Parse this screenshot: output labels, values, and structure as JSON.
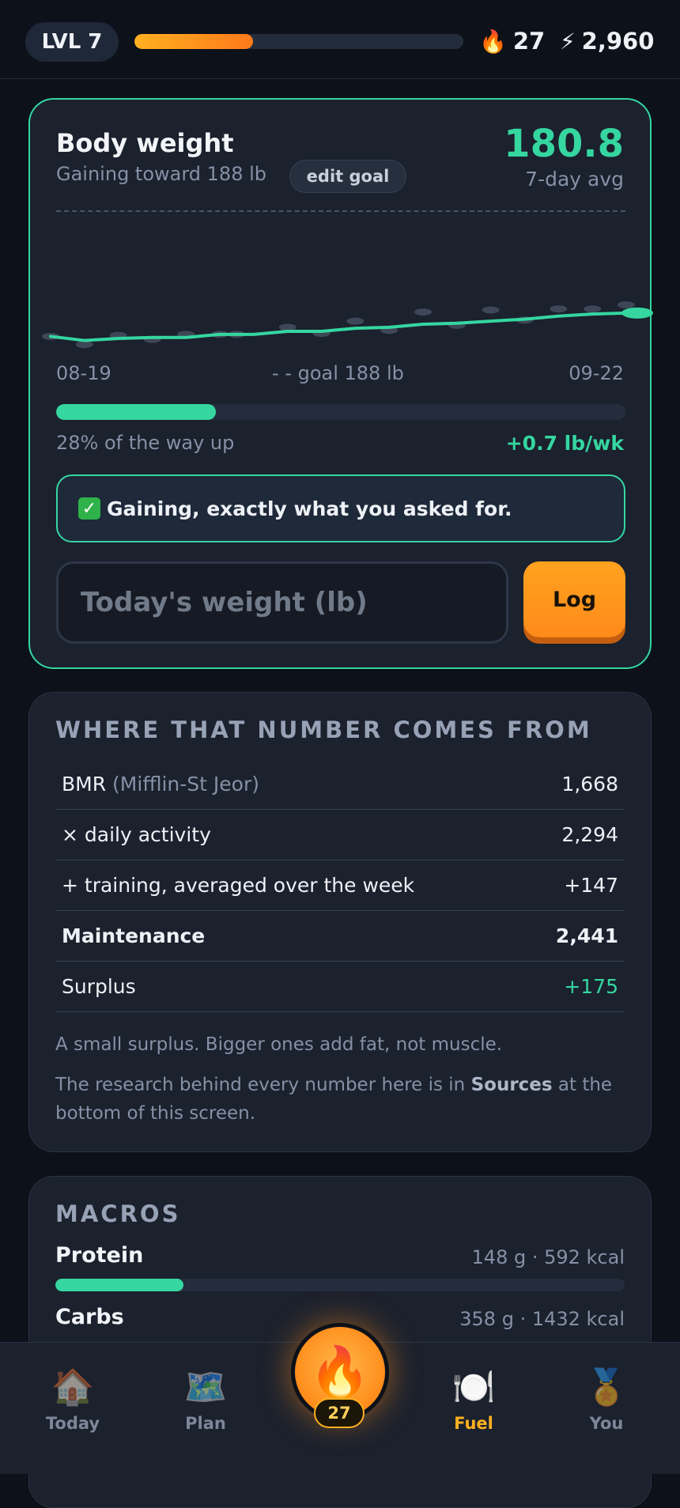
{
  "header": {
    "level": "LVL 7",
    "xp_progress": 0.36,
    "streak": "27",
    "points": "2,960",
    "streak_icon": "flame-icon",
    "points_icon": "lightning-icon"
  },
  "weight_card": {
    "title": "Body weight",
    "subtitle": "Gaining toward 188 lb",
    "edit_goal": "edit goal",
    "value": "180.8",
    "value_caption": "7-day avg",
    "x_start": "08-19",
    "goal_label": "- - goal 188 lb",
    "x_end": "09-22",
    "progress": 0.28,
    "progress_label": "28% of the way up",
    "rate": "+0.7 lb/wk",
    "banner_icon": "check-icon",
    "banner": "Gaining, exactly what you asked for.",
    "input_placeholder": "Today's weight (lb)",
    "log_button": "Log"
  },
  "chart_data": {
    "type": "scatter",
    "title": "",
    "xlabel": "",
    "ylabel": "",
    "x_range": [
      "08-19",
      "09-22"
    ],
    "note": "",
    "daily_weights": [
      {
        "day": 0,
        "weight": 175.6
      },
      {
        "day": 2,
        "weight": 174.8
      },
      {
        "day": 4,
        "weight": 175.7
      },
      {
        "day": 6,
        "weight": 175.3
      },
      {
        "day": 8,
        "weight": 175.8
      },
      {
        "day": 10,
        "weight": 175.8
      },
      {
        "day": 11,
        "weight": 175.8
      },
      {
        "day": 14,
        "weight": 176.5
      },
      {
        "day": 16,
        "weight": 175.9
      },
      {
        "day": 18,
        "weight": 177.1
      },
      {
        "day": 20,
        "weight": 176.2
      },
      {
        "day": 22,
        "weight": 178.0
      },
      {
        "day": 24,
        "weight": 176.7
      },
      {
        "day": 26,
        "weight": 178.2
      },
      {
        "day": 28,
        "weight": 177.2
      },
      {
        "day": 30,
        "weight": 178.3
      },
      {
        "day": 32,
        "weight": 178.3
      },
      {
        "day": 34,
        "weight": 178.7
      }
    ],
    "trend": [
      {
        "day": 0,
        "weight": 175.6
      },
      {
        "day": 2,
        "weight": 175.2
      },
      {
        "day": 4,
        "weight": 175.4
      },
      {
        "day": 6,
        "weight": 175.5
      },
      {
        "day": 8,
        "weight": 175.5
      },
      {
        "day": 10,
        "weight": 175.8
      },
      {
        "day": 12,
        "weight": 175.8
      },
      {
        "day": 14,
        "weight": 176.1
      },
      {
        "day": 16,
        "weight": 176.1
      },
      {
        "day": 18,
        "weight": 176.4
      },
      {
        "day": 20,
        "weight": 176.5
      },
      {
        "day": 22,
        "weight": 176.8
      },
      {
        "day": 24,
        "weight": 176.9
      },
      {
        "day": 26,
        "weight": 177.1
      },
      {
        "day": 28,
        "weight": 177.3
      },
      {
        "day": 30,
        "weight": 177.6
      },
      {
        "day": 32,
        "weight": 177.8
      },
      {
        "day": 34,
        "weight": 177.9
      }
    ],
    "goal_weight": 188,
    "ylim": [
      174,
      188
    ]
  },
  "sources_card": {
    "title": "WHERE THAT NUMBER COMES FROM",
    "rows": [
      {
        "label": "BMR",
        "sub": "(Mifflin-St Jeor)",
        "value": "1,668"
      },
      {
        "label": "× daily activity",
        "sub": "",
        "value": "2,294"
      },
      {
        "label": "+ training, averaged over the week",
        "sub": "",
        "value": "+147"
      },
      {
        "label": "Maintenance",
        "sub": "",
        "value": "2,441"
      },
      {
        "label": "Surplus",
        "sub": "",
        "value": "+175"
      }
    ],
    "note1": "A small surplus. Bigger ones add fat, not muscle.",
    "note2_pre": "The research behind every number here is in ",
    "note2_bold": "Sources",
    "note2_post": " at the bottom of this screen.",
    "surplus_color": "#35d6a0"
  },
  "macros_card": {
    "title": "MACROS",
    "items": [
      {
        "name": "Protein",
        "value": "148 g · 592 kcal",
        "progress": 0.225
      },
      {
        "name": "Carbs",
        "value": "358 g · 1432 kcal",
        "progress": 0
      }
    ]
  },
  "nav": {
    "items": [
      {
        "label": "Today",
        "icon": "house-icon"
      },
      {
        "label": "Plan",
        "icon": "map-icon"
      },
      {
        "label": "Fuel",
        "icon": "plate-icon"
      },
      {
        "label": "You",
        "icon": "medal-icon"
      }
    ],
    "fab_icon": "flame-icon",
    "fab_count": "27",
    "active": "Fuel"
  },
  "colors": {
    "accent": "#35d6a0",
    "orange": "#ff8c1a",
    "background": "#0d1119",
    "card": "#1b212d"
  }
}
